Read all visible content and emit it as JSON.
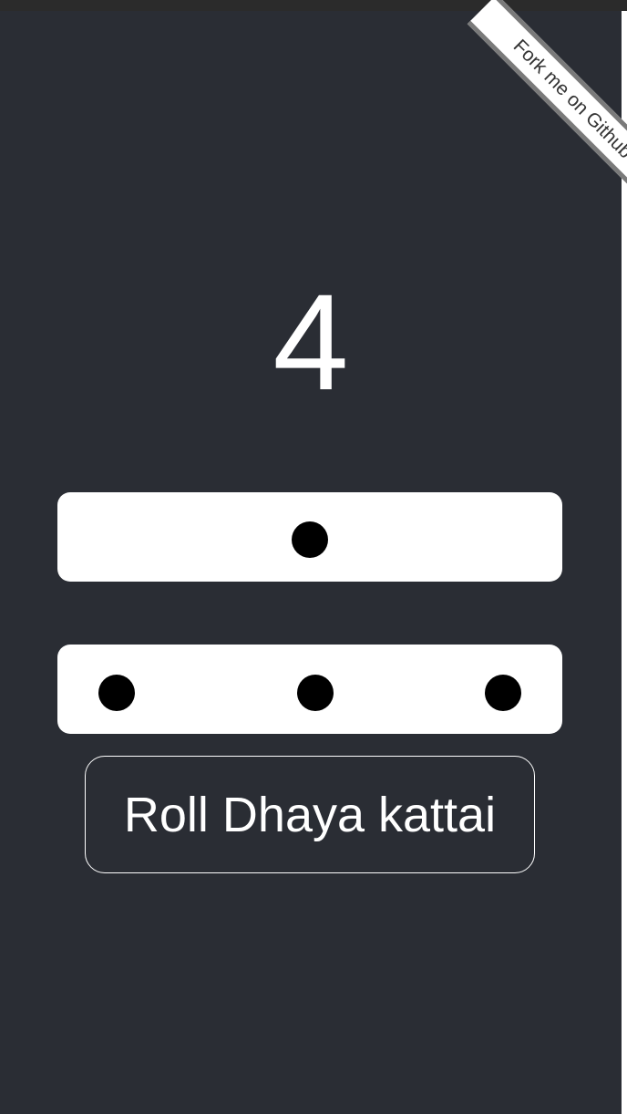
{
  "ribbon": {
    "label": "Fork me on Github"
  },
  "counter": {
    "value": "4"
  },
  "dice": {
    "row1_pips": 1,
    "row2_pips": 3
  },
  "actions": {
    "roll_label": "Roll Dhaya kattai"
  },
  "colors": {
    "background": "#2a2d34",
    "die_face": "#ffffff",
    "pip": "#000000",
    "ribbon_border": "#7a7a7a"
  }
}
